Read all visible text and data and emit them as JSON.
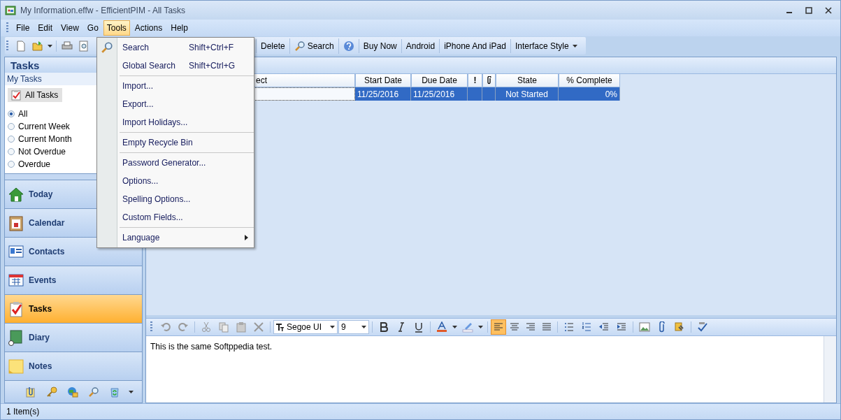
{
  "window": {
    "title": "My Information.effw - EfficientPIM - All Tasks"
  },
  "menu_bar": [
    {
      "label": "File",
      "selected": false
    },
    {
      "label": "Edit",
      "selected": false
    },
    {
      "label": "View",
      "selected": false
    },
    {
      "label": "Go",
      "selected": false
    },
    {
      "label": "Tools",
      "selected": true
    },
    {
      "label": "Actions",
      "selected": false
    },
    {
      "label": "Help",
      "selected": false
    }
  ],
  "toolbar": [
    {
      "kind": "text",
      "label": "Delete"
    },
    {
      "kind": "search",
      "label": "Search"
    },
    {
      "kind": "help"
    },
    {
      "kind": "text",
      "label": "Buy Now"
    },
    {
      "kind": "text",
      "label": "Android"
    },
    {
      "kind": "text",
      "label": "iPhone And iPad"
    },
    {
      "kind": "dropdown",
      "label": "Interface Style"
    }
  ],
  "tools_menu": {
    "groups": [
      [
        {
          "label": "Search",
          "shortcut": "Shift+Ctrl+F"
        },
        {
          "label": "Global Search",
          "shortcut": "Shift+Ctrl+G"
        }
      ],
      [
        {
          "label": "Import..."
        },
        {
          "label": "Export..."
        },
        {
          "label": "Import Holidays..."
        }
      ],
      [
        {
          "label": "Empty Recycle Bin"
        }
      ],
      [
        {
          "label": "Password Generator..."
        },
        {
          "label": "Options..."
        },
        {
          "label": "Spelling Options..."
        },
        {
          "label": "Custom Fields..."
        }
      ],
      [
        {
          "label": "Language",
          "submenu": true
        }
      ]
    ]
  },
  "sidebar": {
    "title": "Tasks",
    "section": "My Tasks",
    "view_button": "All Tasks",
    "filters": [
      {
        "label": "All",
        "selected": true
      },
      {
        "label": "Current Week",
        "selected": false
      },
      {
        "label": "Current Month",
        "selected": false
      },
      {
        "label": "Not Overdue",
        "selected": false
      },
      {
        "label": "Overdue",
        "selected": false
      }
    ],
    "nav": [
      {
        "label": "Today",
        "selected": false
      },
      {
        "label": "Calendar",
        "selected": false
      },
      {
        "label": "Contacts",
        "selected": false
      },
      {
        "label": "Events",
        "selected": false
      },
      {
        "label": "Tasks",
        "selected": true
      },
      {
        "label": "Diary",
        "selected": false
      },
      {
        "label": "Notes",
        "selected": false
      }
    ]
  },
  "table": {
    "columns": [
      "ect",
      "Start Date",
      "Due Date",
      "!",
      "State",
      "% Complete"
    ],
    "rows": [
      {
        "start_date": "11/25/2016",
        "due_date": "11/25/2016",
        "state": "Not Started",
        "complete": "0%",
        "selected": true
      }
    ]
  },
  "editor": {
    "font": "Segoe UI",
    "size": "9",
    "alignments": [
      {
        "selected": true
      },
      {
        "selected": false
      },
      {
        "selected": false
      },
      {
        "selected": false
      }
    ],
    "text": "This is the same Softppedia test."
  },
  "status_bar": {
    "text": "1 Item(s)"
  }
}
